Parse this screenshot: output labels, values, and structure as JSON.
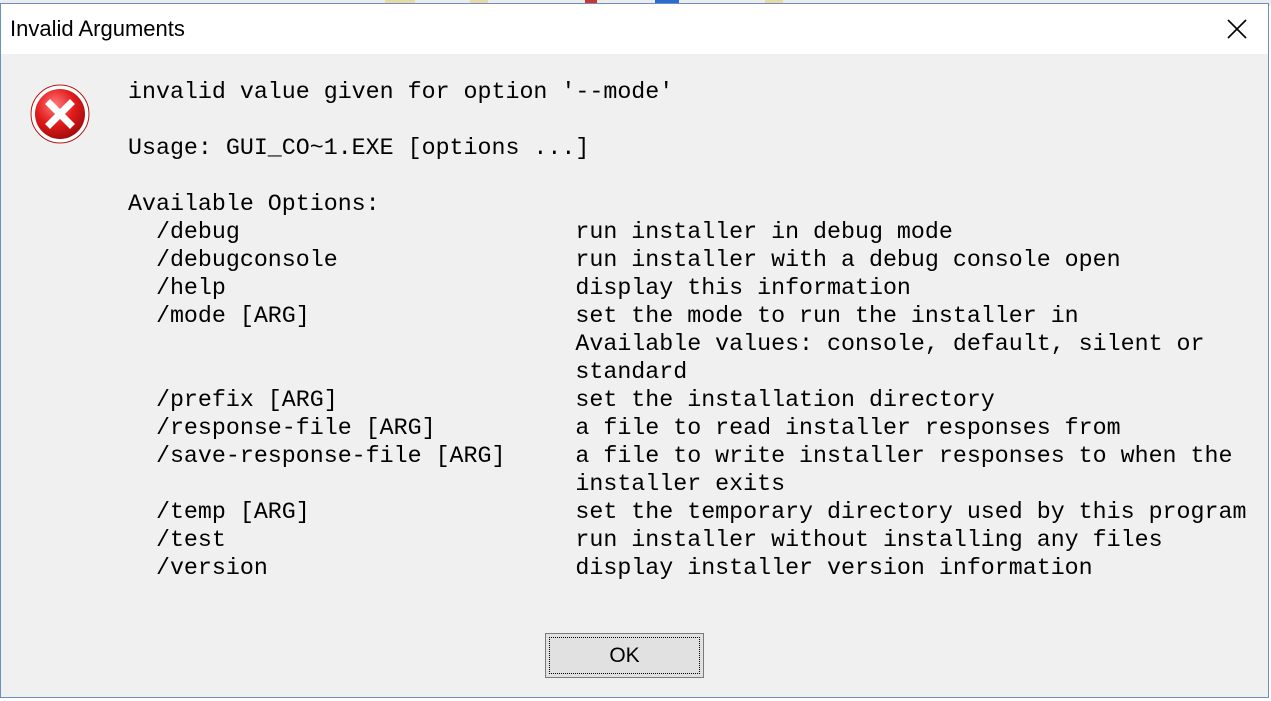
{
  "dialog": {
    "title": "Invalid Arguments",
    "icon": "error-icon",
    "message_lines": [
      "invalid value given for option '--mode'",
      "",
      "Usage: GUI_CO~1.EXE [options ...]",
      "",
      "Available Options:",
      "  /debug                        run installer in debug mode",
      "  /debugconsole                 run installer with a debug console open",
      "  /help                         display this information",
      "  /mode [ARG]                   set the mode to run the installer in",
      "                                Available values: console, default, silent or",
      "                                standard",
      "  /prefix [ARG]                 set the installation directory",
      "  /response-file [ARG]          a file to read installer responses from",
      "  /save-response-file [ARG]     a file to write installer responses to when the",
      "                                installer exits",
      "  /temp [ARG]                   set the temporary directory used by this program",
      "  /test                         run installer without installing any files",
      "  /version                      display installer version information"
    ],
    "ok_label": "OK",
    "colors": {
      "error_red": "#e21b1b",
      "background": "#f0f0f0",
      "border": "#6b8fbf"
    }
  }
}
